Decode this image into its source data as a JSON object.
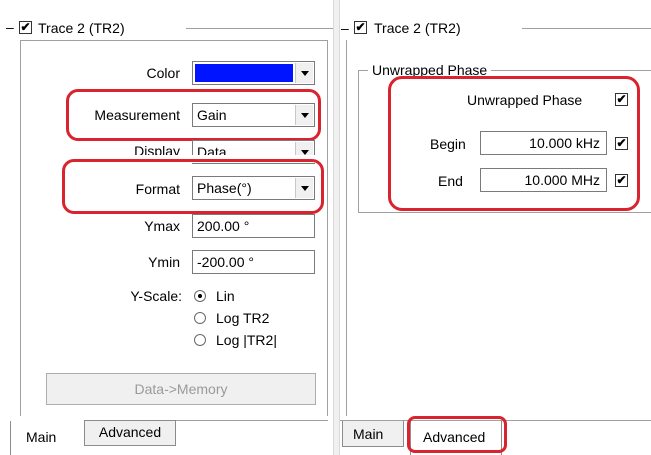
{
  "left": {
    "group_title": "Trace 2 (TR2)",
    "group_checked": true,
    "collapse_symbol": "–",
    "color_label": "Color",
    "color_value": "#0014ff",
    "measurement_label": "Measurement",
    "measurement_value": "Gain",
    "display_label": "Display",
    "display_value": "Data",
    "format_label": "Format",
    "format_value": "Phase(°)",
    "ymax_label": "Ymax",
    "ymax_value": "200.00 °",
    "ymin_label": "Ymin",
    "ymin_value": "-200.00 °",
    "yscale_label": "Y-Scale:",
    "yscale_options": [
      "Lin",
      "Log TR2",
      "Log |TR2|"
    ],
    "yscale_selected": "Lin",
    "data_memory_button": "Data->Memory",
    "tabs": [
      "Main",
      "Advanced"
    ],
    "active_tab": "Main"
  },
  "right": {
    "group_title": "Trace 2 (TR2)",
    "group_checked": true,
    "collapse_symbol": "–",
    "unwrapped_group_title": "Unwrapped Phase",
    "unwrapped_label": "Unwrapped Phase",
    "unwrapped_checked": true,
    "begin_label": "Begin",
    "begin_value": "10.000 kHz",
    "begin_checked": true,
    "end_label": "End",
    "end_value": "10.000 MHz",
    "end_checked": true,
    "tabs": [
      "Main",
      "Advanced"
    ],
    "active_tab": "Advanced"
  },
  "check_glyph": "✔",
  "highlight_color": "#d9232e"
}
